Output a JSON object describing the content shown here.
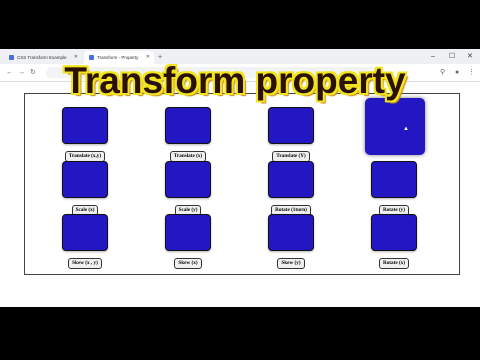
{
  "browser": {
    "tabs": [
      {
        "label": "CSS Transform Example",
        "active": false
      },
      {
        "label": "Transform - Property",
        "active": true
      }
    ],
    "new_tab": "+",
    "window_controls": {
      "minimize": "–",
      "maximize": "☐",
      "close": "✕"
    },
    "nav": {
      "back": "←",
      "forward": "→",
      "reload": "↻"
    }
  },
  "overlay": {
    "title": "Transform property"
  },
  "grid": {
    "square_color": "#2217c2",
    "buttons": [
      [
        "Translate (x,y)",
        "Translate (x)",
        "Translate (Y)"
      ],
      [
        "Scale (x)",
        "Scale (y)",
        "Rotate (1turn)",
        "Rotate (y)"
      ],
      [
        "Skew (x , y)",
        "Skew (x)",
        "Skew (y)",
        "Rotate (x)"
      ]
    ]
  }
}
